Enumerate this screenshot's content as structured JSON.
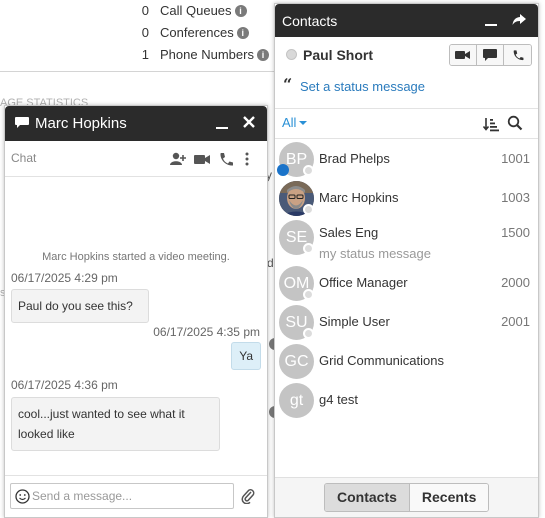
{
  "stats": [
    {
      "count": "0",
      "label": "Call Queues"
    },
    {
      "count": "0",
      "label": "Conferences"
    },
    {
      "count": "1",
      "label": "Phone Numbers"
    }
  ],
  "background_fragments": {
    "section_heading": "AGE STATISTICS",
    "s1": "y",
    "s2": "d",
    "s3": "s"
  },
  "chat": {
    "title": "Marc Hopkins",
    "sub_label": "Chat",
    "messages": {
      "system": "Marc Hopkins started a video meeting.",
      "m1_time": "06/17/2025 4:29 pm",
      "m1_text": "Paul do you see this?",
      "m2_time": "06/17/2025 4:35 pm",
      "m2_text": "Ya",
      "m3_time": "06/17/2025 4:36 pm",
      "m3_text": "cool...just wanted to see what it looked like"
    },
    "input_placeholder": "Send a message..."
  },
  "contacts": {
    "title": "Contacts",
    "self_name": "Paul Short",
    "status_link": "Set a status message",
    "filter": "All",
    "list": [
      {
        "initials": "BP",
        "name": "Brad Phelps",
        "ext": "1001",
        "sub": ""
      },
      {
        "initials": "",
        "name": "Marc Hopkins",
        "ext": "1003",
        "sub": ""
      },
      {
        "initials": "SE",
        "name": "Sales Eng",
        "ext": "1500",
        "sub": "my status message"
      },
      {
        "initials": "OM",
        "name": "Office Manager",
        "ext": "2000",
        "sub": ""
      },
      {
        "initials": "SU",
        "name": "Simple User",
        "ext": "2001",
        "sub": ""
      },
      {
        "initials": "GC",
        "name": "Grid Communications",
        "ext": "",
        "sub": ""
      },
      {
        "initials": "gt",
        "name": "g4 test",
        "ext": "",
        "sub": ""
      }
    ],
    "tabs": {
      "contacts": "Contacts",
      "recents": "Recents"
    }
  },
  "colors": {
    "header_bg": "#2b2b2b",
    "link_blue": "#2a7bbd",
    "filter_blue": "#2a90d6",
    "presence_blue": "#1a73c9",
    "avatar_gray": "#c4c4c4",
    "outgoing_bubble": "#ddeff8"
  },
  "icons": {
    "chat_header": "speech-bubble-icon",
    "minimize": "minimize-icon",
    "close": "close-icon",
    "add_user": "add-user-icon",
    "video": "video-camera-icon",
    "phone": "phone-icon",
    "more": "vertical-dots-icon",
    "emoji": "smiley-icon",
    "attach": "paperclip-icon",
    "popout": "popout-arrow-icon",
    "quote": "quote-icon",
    "sort": "sort-icon",
    "search": "search-icon"
  }
}
